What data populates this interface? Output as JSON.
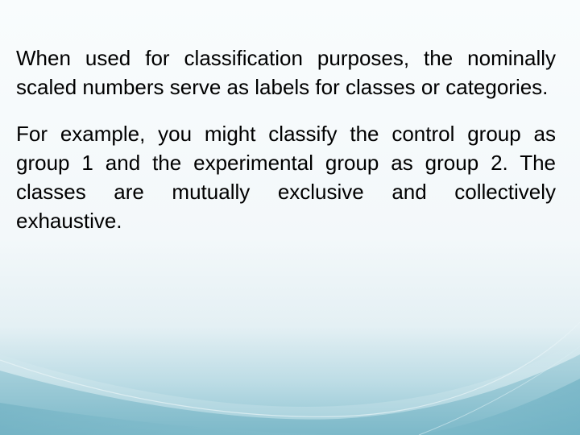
{
  "slide": {
    "paragraphs": [
      "When used for classification purposes, the nominally scaled numbers serve as labels for classes or categories.",
      "For example, you might classify the control group as group 1 and the experimental group as group 2. The classes are mutually exclusive and collectively exhaustive."
    ]
  },
  "theme": {
    "background_top": "#f9fcfd",
    "wave_light": "#c9e3ea",
    "wave_mid": "#9ccad6",
    "wave_dark": "#72b1c3",
    "text_color": "#000000"
  }
}
